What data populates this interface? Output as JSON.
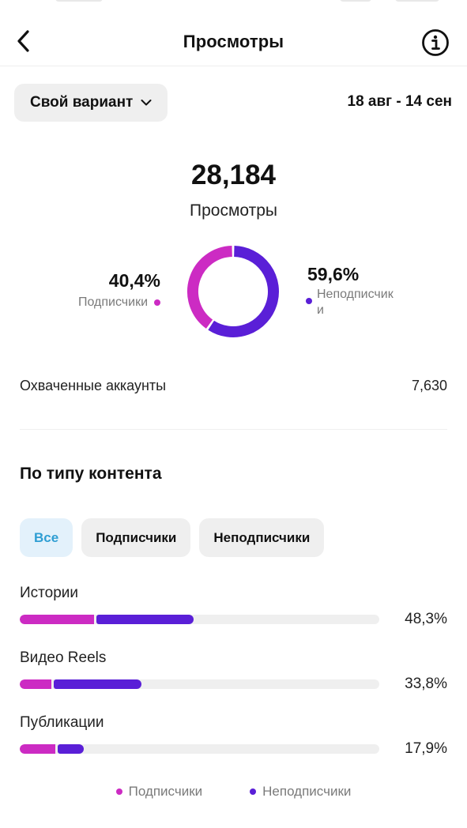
{
  "header": {
    "title": "Просмотры",
    "back_icon": "chevron-left-icon",
    "info_icon": "info-icon"
  },
  "filter": {
    "range_label": "Свой вариант",
    "date_range": "18 авг - 14 сен"
  },
  "summary": {
    "total": "28,184",
    "total_label": "Просмотры",
    "followers_pct": "40,4%",
    "followers_label": "Подписчики",
    "nonfollowers_pct": "59,6%",
    "nonfollowers_label": "Неподписчик\nи",
    "followers_fraction": 0.404,
    "nonfollowers_fraction": 0.596
  },
  "reach": {
    "label": "Охваченные аккаунты",
    "value": "7,630"
  },
  "content_type": {
    "title": "По типу контента",
    "tabs": [
      "Все",
      "Подписчики",
      "Неподписчики"
    ],
    "active_tab": "Все",
    "rows": [
      {
        "name": "Истории",
        "pct": "48,3%",
        "total": 48.3,
        "followers_share": 0.43
      },
      {
        "name": "Видео Reels",
        "pct": "33,8%",
        "total": 33.8,
        "followers_share": 0.26
      },
      {
        "name": "Публикации",
        "pct": "17,9%",
        "total": 17.9,
        "followers_share": 0.55
      }
    ]
  },
  "legend": {
    "followers": "Подписчики",
    "nonfollowers": "Неподписчики"
  },
  "colors": {
    "followers": "#cc2bc3",
    "nonfollowers": "#5a1fd7",
    "active_chip_text": "#2f9ed3",
    "active_chip_bg": "#e3f1fb",
    "track": "#efefef"
  }
}
